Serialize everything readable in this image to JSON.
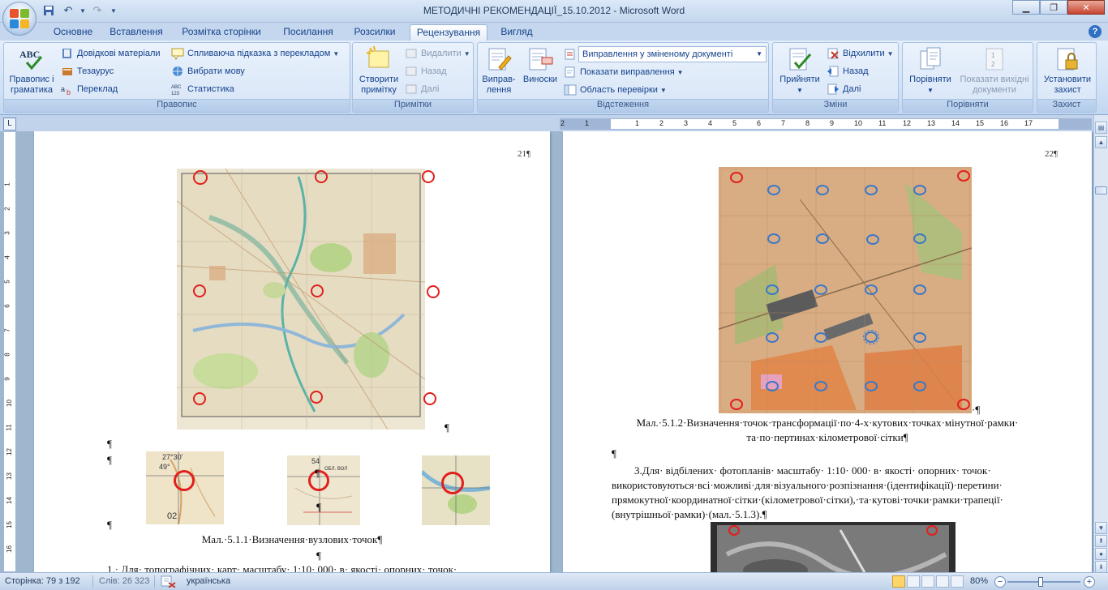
{
  "window": {
    "title": "МЕТОДИЧНІ РЕКОМЕНДАЦІЇ_15.10.2012 - Microsoft Word",
    "controls": [
      "minimize",
      "restore",
      "close"
    ]
  },
  "quick_access": [
    "save-icon",
    "undo-icon",
    "redo-icon",
    "customize-icon"
  ],
  "tabs": [
    {
      "label": "Основне"
    },
    {
      "label": "Вставлення"
    },
    {
      "label": "Розмітка сторінки"
    },
    {
      "label": "Посилання"
    },
    {
      "label": "Розсилки"
    },
    {
      "label": "Рецензування",
      "active": true
    },
    {
      "label": "Вигляд"
    }
  ],
  "ribbon": {
    "groups": {
      "proofing": {
        "label": "Правопис",
        "spelling": "Правопис і граматика",
        "research": "Довідкові матеріали",
        "thesaurus": "Тезаурус",
        "translate": "Переклад",
        "tooltip_translate": "Спливаюча підказка з перекладом",
        "set_language": "Вибрати мову",
        "word_count": "Статистика"
      },
      "comments": {
        "label": "Примітки",
        "new_comment": "Створити примітку",
        "delete": "Видалити",
        "previous": "Назад",
        "next": "Далі"
      },
      "tracking": {
        "label": "Відстеження",
        "track_changes": "Виправ-лення",
        "balloons": "Виноски",
        "display_mode": "Виправлення у зміненому документі",
        "show_markup": "Показати виправлення",
        "reviewing_pane": "Область перевірки"
      },
      "changes": {
        "label": "Зміни",
        "accept": "Прийняти",
        "reject": "Відхилити",
        "previous": "Назад",
        "next": "Далі"
      },
      "compare": {
        "label": "Порівняти",
        "compare": "Порівняти",
        "show_source": "Показати вихідні документи"
      },
      "protect": {
        "label": "Захист",
        "protect_document": "Установити захист"
      }
    }
  },
  "ruler": {
    "h_ticks": [
      "2",
      "1",
      "1",
      "2",
      "3",
      "4",
      "5",
      "6",
      "7",
      "8",
      "9",
      "10",
      "11",
      "12",
      "13",
      "14",
      "15",
      "16",
      "17"
    ],
    "v_ticks": [
      "1",
      "2",
      "3",
      "4",
      "5",
      "6",
      "7",
      "8",
      "9",
      "10",
      "11",
      "12",
      "13",
      "14",
      "15",
      "16"
    ]
  },
  "page_left": {
    "page_number": "21¶",
    "pilcrows": [
      "¶",
      "¶",
      "¶",
      "¶",
      "¶",
      "¶",
      "¶"
    ],
    "caption": "Мал.·5.1.1·Визначення·вузлових·точок¶",
    "para_start": "1.· Для· топографічних· карт· масштабу· 1:10· 000· в· якості· опорних· точок·",
    "thumb_labels": [
      "27°30'",
      "49°",
      "02",
      "54",
      "ОБЛ. ВОЛ"
    ]
  },
  "page_right": {
    "page_number": "22¶",
    "caption_line1": "Мал.·5.1.2·Визначення·точок·трансформації·по·4-х·кутових·точках·мінутної·рамки·",
    "caption_line2": "та·по·пертинах·кілометрової·сітки¶",
    "pilcrow_after_map": "·¶",
    "empty_para": "¶",
    "para_lines": [
      "3.Для· відбілених· фотопланів· масштабу· 1:10· 000· в· якості· опорних· точок·",
      "використовуються·всі·можливі·для·візуального·розпізнання·(ідентифікації)·перетини·",
      "прямокутної·координатної·сітки·(кілометрової·сітки),·та·кутові·точки·рамки·трапеції·",
      "(внутрішньої·рамки)·(мал.·5.1.3).¶"
    ]
  },
  "statusbar": {
    "page": "Сторінка: 79 з 192",
    "words": "Слів: 26 323",
    "language": "українська",
    "zoom": "80%"
  },
  "colors": {
    "accent": "#15428b",
    "red_marker": "#e0201c",
    "blue_marker": "#3c78c8"
  }
}
